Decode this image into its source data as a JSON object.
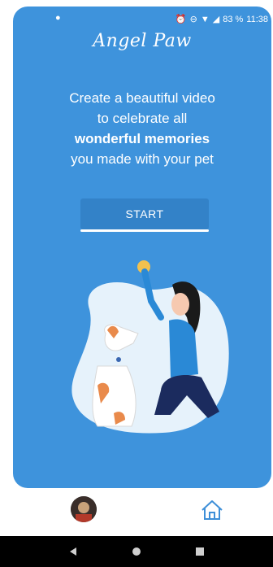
{
  "status_bar": {
    "notification_icon": "chat-bubble-icon",
    "icons": [
      "alarm-icon",
      "do-not-disturb-icon",
      "wifi-icon",
      "signal-icon"
    ],
    "battery": "83 %",
    "time": "11:38"
  },
  "header": {
    "logo_text": "Angel Paw"
  },
  "main": {
    "headline_line1": "Create a beautiful video",
    "headline_line2": "to celebrate all",
    "headline_bold": "wonderful memories",
    "headline_line4": "you made with your pet",
    "start_label": "START",
    "illustration": "woman-playing-with-dog-illustration"
  },
  "bottom_nav": {
    "items": [
      {
        "icon": "profile-avatar"
      },
      {
        "icon": "home-icon"
      }
    ]
  },
  "system_nav": {
    "items": [
      "back-icon",
      "home-circle-icon",
      "recents-icon"
    ]
  },
  "colors": {
    "card_bg": "#3e93dc",
    "button_bg": "#3382c8",
    "blob": "#e6f2fb",
    "shirt": "#2a89d6",
    "jeans": "#1b2b5e",
    "ball": "#f2c14e",
    "dog_patch": "#e98a4b"
  }
}
